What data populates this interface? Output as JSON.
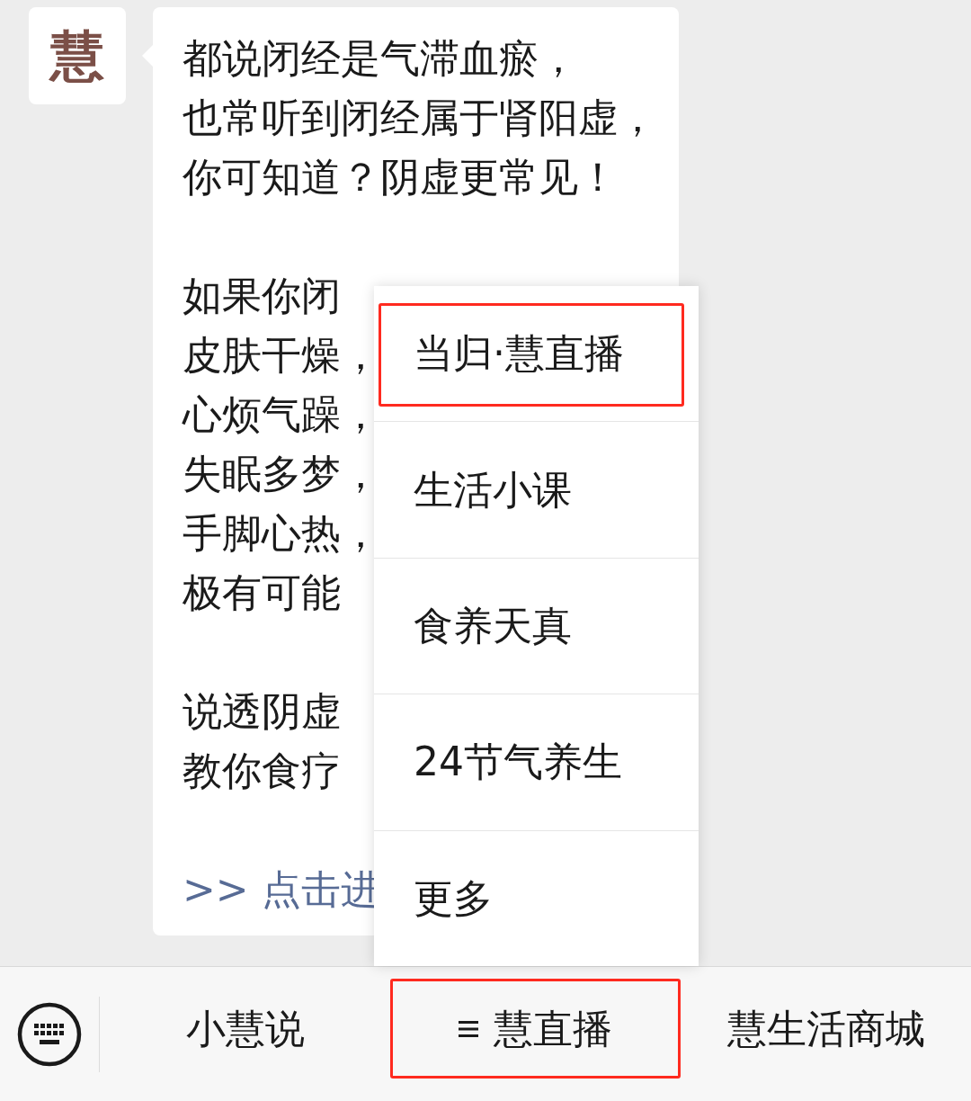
{
  "avatar": {
    "text": "慧"
  },
  "message": {
    "paragraphs": [
      [
        "都说闭经是气滞血瘀，",
        "也常听到闭经属于肾阳虚，",
        "你可知道？阴虚更常见！"
      ],
      [
        "如果你闭",
        "皮肤干燥，",
        "心烦气躁，",
        "失眠多梦，",
        "手脚心热，",
        "极有可能"
      ],
      [
        "说透阴虚",
        "教你食疗"
      ]
    ],
    "link": ">> 点击进"
  },
  "popup_menu": {
    "items": [
      {
        "label": "当归·慧直播",
        "highlighted": true
      },
      {
        "label": "生活小课",
        "highlighted": false
      },
      {
        "label": "食养天真",
        "highlighted": false
      },
      {
        "label": "24节气养生",
        "highlighted": false
      },
      {
        "label": "更多",
        "highlighted": false
      }
    ]
  },
  "menu_bar": {
    "items": [
      {
        "label": "小慧说",
        "kind": "plain",
        "highlighted": false
      },
      {
        "label": "慧直播",
        "kind": "submenu",
        "highlighted": true
      },
      {
        "label": "慧生活商城",
        "kind": "plain",
        "highlighted": false
      }
    ]
  }
}
